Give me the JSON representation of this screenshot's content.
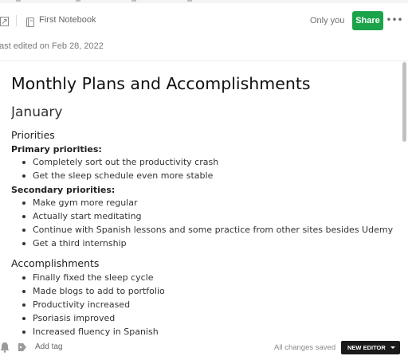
{
  "header": {
    "notebook_label": "First Notebook",
    "share_scope": "Only you",
    "share_label": "Share",
    "more_label": "•••"
  },
  "meta": {
    "last_edited": "ast edited on Feb 28, 2022"
  },
  "note": {
    "title": "Monthly Plans and Accomplishments",
    "month": "January",
    "priorities_heading": "Priorities",
    "primary_label": "Primary priorities:",
    "primary_items": [
      "Completely sort out the productivity crash",
      "Get the sleep schedule even more stable"
    ],
    "secondary_label": "Secondary priorities:",
    "secondary_items": [
      "Make gym more regular",
      "Actually start meditating",
      "Continue with Spanish lessons and some practice from other sites besides Udemy",
      "Get a third internship"
    ],
    "accomplishments_heading": "Accomplishments",
    "accomplishment_items": [
      "Finally fixed the sleep cycle",
      "Made blogs to add to portfolio",
      "Productivity increased",
      "Psoriasis improved",
      "Increased fluency in Spanish"
    ]
  },
  "footer": {
    "add_tag": "Add tag",
    "saved_status": "All changes saved",
    "new_editor": "NEW EDITOR"
  },
  "colors": {
    "accent": "#1ba34a",
    "text": "#333333",
    "new_editor_bg": "#1a1a1a"
  },
  "icons": {
    "expand": "expand-icon",
    "notebook": "notebook-icon",
    "reminder": "reminder-icon",
    "tag": "tag-icon",
    "more": "more-icon",
    "caret": "caret-down-icon"
  }
}
